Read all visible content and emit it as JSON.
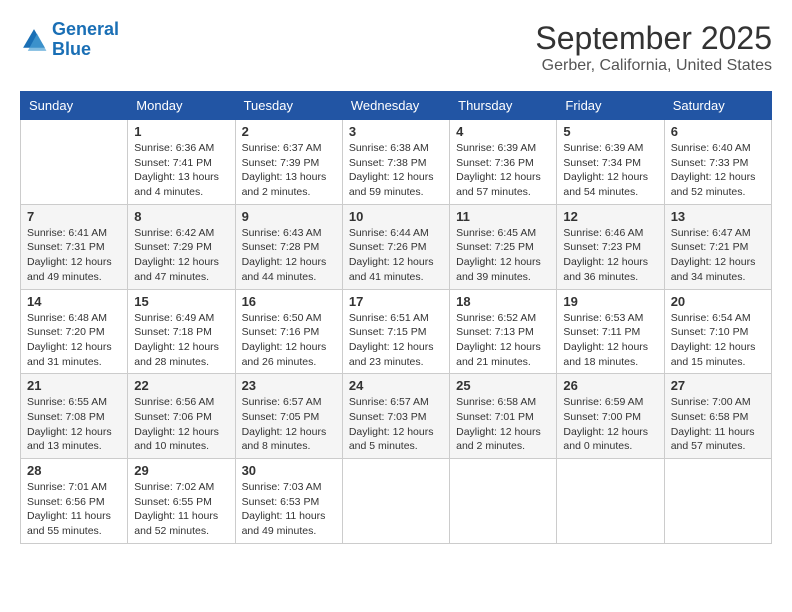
{
  "header": {
    "logo_line1": "General",
    "logo_line2": "Blue",
    "title": "September 2025",
    "subtitle": "Gerber, California, United States"
  },
  "weekdays": [
    "Sunday",
    "Monday",
    "Tuesday",
    "Wednesday",
    "Thursday",
    "Friday",
    "Saturday"
  ],
  "weeks": [
    [
      {
        "day": "",
        "sunrise": "",
        "sunset": "",
        "daylight": ""
      },
      {
        "day": "1",
        "sunrise": "Sunrise: 6:36 AM",
        "sunset": "Sunset: 7:41 PM",
        "daylight": "Daylight: 13 hours and 4 minutes."
      },
      {
        "day": "2",
        "sunrise": "Sunrise: 6:37 AM",
        "sunset": "Sunset: 7:39 PM",
        "daylight": "Daylight: 13 hours and 2 minutes."
      },
      {
        "day": "3",
        "sunrise": "Sunrise: 6:38 AM",
        "sunset": "Sunset: 7:38 PM",
        "daylight": "Daylight: 12 hours and 59 minutes."
      },
      {
        "day": "4",
        "sunrise": "Sunrise: 6:39 AM",
        "sunset": "Sunset: 7:36 PM",
        "daylight": "Daylight: 12 hours and 57 minutes."
      },
      {
        "day": "5",
        "sunrise": "Sunrise: 6:39 AM",
        "sunset": "Sunset: 7:34 PM",
        "daylight": "Daylight: 12 hours and 54 minutes."
      },
      {
        "day": "6",
        "sunrise": "Sunrise: 6:40 AM",
        "sunset": "Sunset: 7:33 PM",
        "daylight": "Daylight: 12 hours and 52 minutes."
      }
    ],
    [
      {
        "day": "7",
        "sunrise": "Sunrise: 6:41 AM",
        "sunset": "Sunset: 7:31 PM",
        "daylight": "Daylight: 12 hours and 49 minutes."
      },
      {
        "day": "8",
        "sunrise": "Sunrise: 6:42 AM",
        "sunset": "Sunset: 7:29 PM",
        "daylight": "Daylight: 12 hours and 47 minutes."
      },
      {
        "day": "9",
        "sunrise": "Sunrise: 6:43 AM",
        "sunset": "Sunset: 7:28 PM",
        "daylight": "Daylight: 12 hours and 44 minutes."
      },
      {
        "day": "10",
        "sunrise": "Sunrise: 6:44 AM",
        "sunset": "Sunset: 7:26 PM",
        "daylight": "Daylight: 12 hours and 41 minutes."
      },
      {
        "day": "11",
        "sunrise": "Sunrise: 6:45 AM",
        "sunset": "Sunset: 7:25 PM",
        "daylight": "Daylight: 12 hours and 39 minutes."
      },
      {
        "day": "12",
        "sunrise": "Sunrise: 6:46 AM",
        "sunset": "Sunset: 7:23 PM",
        "daylight": "Daylight: 12 hours and 36 minutes."
      },
      {
        "day": "13",
        "sunrise": "Sunrise: 6:47 AM",
        "sunset": "Sunset: 7:21 PM",
        "daylight": "Daylight: 12 hours and 34 minutes."
      }
    ],
    [
      {
        "day": "14",
        "sunrise": "Sunrise: 6:48 AM",
        "sunset": "Sunset: 7:20 PM",
        "daylight": "Daylight: 12 hours and 31 minutes."
      },
      {
        "day": "15",
        "sunrise": "Sunrise: 6:49 AM",
        "sunset": "Sunset: 7:18 PM",
        "daylight": "Daylight: 12 hours and 28 minutes."
      },
      {
        "day": "16",
        "sunrise": "Sunrise: 6:50 AM",
        "sunset": "Sunset: 7:16 PM",
        "daylight": "Daylight: 12 hours and 26 minutes."
      },
      {
        "day": "17",
        "sunrise": "Sunrise: 6:51 AM",
        "sunset": "Sunset: 7:15 PM",
        "daylight": "Daylight: 12 hours and 23 minutes."
      },
      {
        "day": "18",
        "sunrise": "Sunrise: 6:52 AM",
        "sunset": "Sunset: 7:13 PM",
        "daylight": "Daylight: 12 hours and 21 minutes."
      },
      {
        "day": "19",
        "sunrise": "Sunrise: 6:53 AM",
        "sunset": "Sunset: 7:11 PM",
        "daylight": "Daylight: 12 hours and 18 minutes."
      },
      {
        "day": "20",
        "sunrise": "Sunrise: 6:54 AM",
        "sunset": "Sunset: 7:10 PM",
        "daylight": "Daylight: 12 hours and 15 minutes."
      }
    ],
    [
      {
        "day": "21",
        "sunrise": "Sunrise: 6:55 AM",
        "sunset": "Sunset: 7:08 PM",
        "daylight": "Daylight: 12 hours and 13 minutes."
      },
      {
        "day": "22",
        "sunrise": "Sunrise: 6:56 AM",
        "sunset": "Sunset: 7:06 PM",
        "daylight": "Daylight: 12 hours and 10 minutes."
      },
      {
        "day": "23",
        "sunrise": "Sunrise: 6:57 AM",
        "sunset": "Sunset: 7:05 PM",
        "daylight": "Daylight: 12 hours and 8 minutes."
      },
      {
        "day": "24",
        "sunrise": "Sunrise: 6:57 AM",
        "sunset": "Sunset: 7:03 PM",
        "daylight": "Daylight: 12 hours and 5 minutes."
      },
      {
        "day": "25",
        "sunrise": "Sunrise: 6:58 AM",
        "sunset": "Sunset: 7:01 PM",
        "daylight": "Daylight: 12 hours and 2 minutes."
      },
      {
        "day": "26",
        "sunrise": "Sunrise: 6:59 AM",
        "sunset": "Sunset: 7:00 PM",
        "daylight": "Daylight: 12 hours and 0 minutes."
      },
      {
        "day": "27",
        "sunrise": "Sunrise: 7:00 AM",
        "sunset": "Sunset: 6:58 PM",
        "daylight": "Daylight: 11 hours and 57 minutes."
      }
    ],
    [
      {
        "day": "28",
        "sunrise": "Sunrise: 7:01 AM",
        "sunset": "Sunset: 6:56 PM",
        "daylight": "Daylight: 11 hours and 55 minutes."
      },
      {
        "day": "29",
        "sunrise": "Sunrise: 7:02 AM",
        "sunset": "Sunset: 6:55 PM",
        "daylight": "Daylight: 11 hours and 52 minutes."
      },
      {
        "day": "30",
        "sunrise": "Sunrise: 7:03 AM",
        "sunset": "Sunset: 6:53 PM",
        "daylight": "Daylight: 11 hours and 49 minutes."
      },
      {
        "day": "",
        "sunrise": "",
        "sunset": "",
        "daylight": ""
      },
      {
        "day": "",
        "sunrise": "",
        "sunset": "",
        "daylight": ""
      },
      {
        "day": "",
        "sunrise": "",
        "sunset": "",
        "daylight": ""
      },
      {
        "day": "",
        "sunrise": "",
        "sunset": "",
        "daylight": ""
      }
    ]
  ]
}
